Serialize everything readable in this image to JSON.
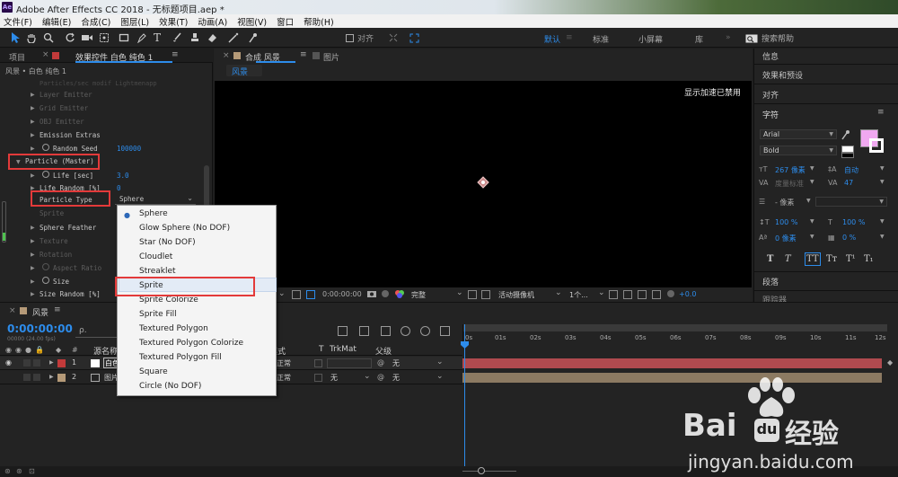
{
  "window": {
    "title": "Adobe After Effects CC 2018 - 无标题项目.aep *",
    "app_icon_text": "Ae"
  },
  "menu": [
    "文件(F)",
    "编辑(E)",
    "合成(C)",
    "图层(L)",
    "效果(T)",
    "动画(A)",
    "视图(V)",
    "窗口",
    "帮助(H)"
  ],
  "toolbar": {
    "snap_label": "对齐",
    "workspaces": [
      "默认",
      "标准",
      "小屏幕",
      "库"
    ],
    "search_placeholder": "搜索帮助"
  },
  "left_panel": {
    "tab_project": "项目",
    "tab_effect_controls": "效果控件 白色 纯色 1",
    "breadcrumb": "风景 • 白色 纯色 1",
    "dimmed_top": "Particles/sec modif  Lightmenapp",
    "properties": [
      {
        "label": "Layer Emitter",
        "dim": true
      },
      {
        "label": "Grid Emitter",
        "dim": true
      },
      {
        "label": "OBJ Emitter",
        "dim": true
      },
      {
        "label": "Emission Extras",
        "dim": false
      },
      {
        "label": "Random Seed",
        "dim": false,
        "value": "100000",
        "stopwatch": true
      }
    ],
    "group_label": "Particle (Master)",
    "group_props": [
      {
        "label": "Life [sec]",
        "value": "3.0",
        "stopwatch": true
      },
      {
        "label": "Life Random [%]",
        "value": "0"
      },
      {
        "label": "Particle Type",
        "value": "Sphere",
        "select": true
      },
      {
        "label": "Sprite",
        "dim": true
      },
      {
        "label": "Sphere Feather"
      },
      {
        "label": "Texture",
        "dim": true
      },
      {
        "label": "Rotation",
        "dim": true
      },
      {
        "label": "Aspect Ratio",
        "dim": true,
        "stopwatch": true
      },
      {
        "label": "Size",
        "stopwatch": true
      },
      {
        "label": "Size Random [%]"
      }
    ]
  },
  "viewer": {
    "tab_comp": "合成 风景",
    "tab_footage": "图片",
    "breadcrumb": "风景",
    "gpu_message": "显示加速已禁用",
    "timecode": "0:00:00:00",
    "quality": "完整",
    "camera": "活动摄像机",
    "views": "1个...",
    "exposure": "+0.0"
  },
  "right_panel": {
    "info": "信息",
    "effects_presets": "效果和预设",
    "align": "对齐",
    "character": "字符",
    "font": "Arial",
    "style": "Bold",
    "font_size": "267 像素",
    "leading": "自动",
    "kerning": "度量标准",
    "tracking": "47",
    "stroke_width": "- 像素",
    "vscale": "100 %",
    "hscale": "100 %",
    "baseline": "0 像素",
    "tsume": "0 %",
    "type_buttons": [
      "T",
      "T",
      "TT",
      "Tт",
      "T¹",
      "T₁"
    ],
    "paragraph": "段落",
    "tracker": "跟踪器",
    "colors": {
      "fill": "#f0a8f0",
      "stroke": "#ffffff"
    }
  },
  "timeline": {
    "comp_name": "风景",
    "timecode": "0:00:00:00",
    "timecode_sub": "00000 (24.00 fps)",
    "search_placeholder": "ρ.",
    "col_source": "源名称",
    "col_mode": "模式",
    "col_t": "T",
    "col_trkmat": "TrkMat",
    "col_parent": "父级",
    "ruler": [
      "0s",
      "01s",
      "02s",
      "03s",
      "04s",
      "05s",
      "06s",
      "07s",
      "08s",
      "09s",
      "10s",
      "11s",
      "12s"
    ],
    "layers": [
      {
        "index": "1",
        "name": "白色",
        "mode": "正常",
        "trkmat": "",
        "parent": "无",
        "color": "#c23a3a"
      },
      {
        "index": "2",
        "name": "图片",
        "mode": "正常",
        "trkmat": "无",
        "parent": "无",
        "color": "#b59a78"
      }
    ]
  },
  "dropdown": {
    "items": [
      "Sphere",
      "Glow Sphere (No DOF)",
      "Star (No DOF)",
      "Cloudlet",
      "Streaklet",
      "Sprite",
      "Sprite Colorize",
      "Sprite Fill",
      "Textured Polygon",
      "Textured Polygon Colorize",
      "Textured Polygon Fill",
      "Square",
      "Circle (No DOF)"
    ],
    "checked": "Sphere",
    "hovered": "Sprite"
  },
  "watermark": {
    "brand": "Bai",
    "brand2": "du",
    "cn": "经验",
    "url": "jingyan.baidu.com"
  }
}
